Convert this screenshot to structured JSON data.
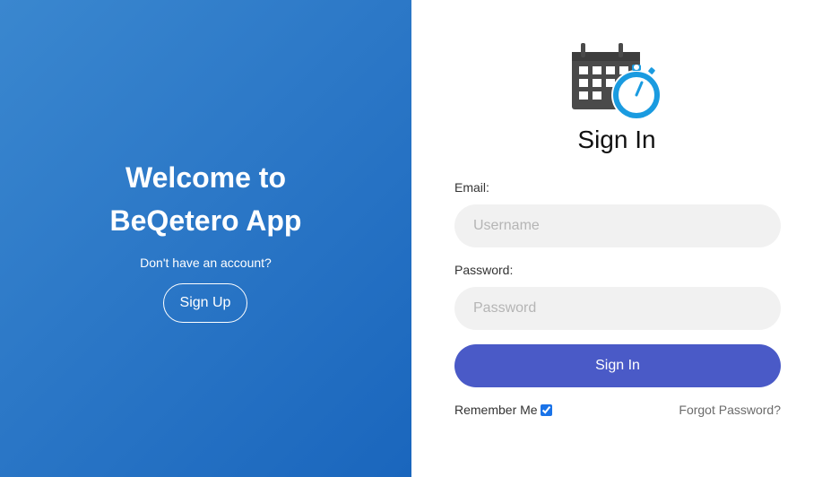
{
  "left_panel": {
    "welcome_title": "Welcome to\nBeQetero App",
    "no_account_text": "Don't have an account?",
    "signup_label": "Sign Up"
  },
  "right_panel": {
    "logo_icon": "calendar-stopwatch-icon",
    "title": "Sign In",
    "email": {
      "label": "Email:",
      "placeholder": "Username",
      "value": ""
    },
    "password": {
      "label": "Password:",
      "placeholder": "Password",
      "value": ""
    },
    "signin_label": "Sign In",
    "remember_label": "Remember Me",
    "remember_checked": true,
    "forgot_label": "Forgot Password?"
  },
  "colors": {
    "left_gradient_start": "#3a87cf",
    "left_gradient_end": "#1a66bd",
    "signin_button": "#4a5ac7",
    "input_background": "#f1f1f1",
    "logo_calendar": "#4a4a4a",
    "logo_stopwatch": "#1a9be0"
  }
}
